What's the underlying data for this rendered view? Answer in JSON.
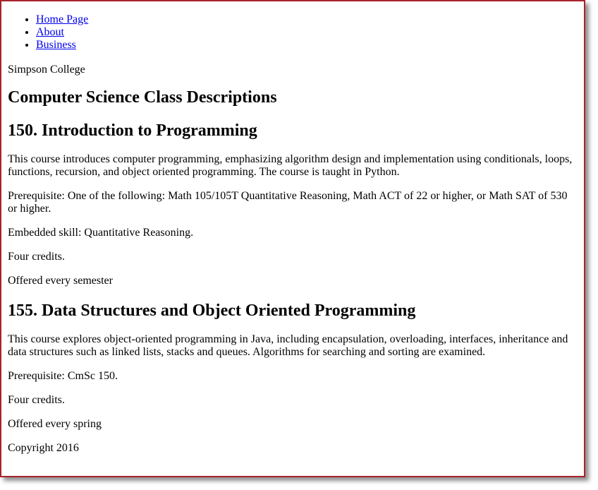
{
  "nav": {
    "items": [
      {
        "label": "Home Page"
      },
      {
        "label": "About"
      },
      {
        "label": "Business"
      }
    ]
  },
  "site_name": "Simpson College",
  "page_title": "Computer Science Class Descriptions",
  "courses": [
    {
      "title": "150. Introduction to Programming",
      "description": "This course introduces computer programming, emphasizing algorithm design and implementation using conditionals, loops, functions, recursion, and object oriented programming. The course is taught in Python.",
      "prerequisite": "Prerequisite: One of the following: Math 105/105T Quantitative Reasoning, Math ACT of 22 or higher, or Math SAT of 530 or higher.",
      "skill": "Embedded skill: Quantitative Reasoning.",
      "credits": "Four credits.",
      "offered": "Offered every semester"
    },
    {
      "title": "155. Data Structures and Object Oriented Programming",
      "description": "This course explores object-oriented programming in Java, including encapsulation, overloading, interfaces, inheritance and data structures such as linked lists, stacks and queues. Algorithms for searching and sorting are examined.",
      "prerequisite": "Prerequisite: CmSc 150.",
      "credits": "Four credits.",
      "offered": "Offered every spring"
    }
  ],
  "footer": "Copyright 2016",
  "colors": {
    "link": "#0000ee",
    "frame_border": "#a8232b",
    "text": "#000000"
  }
}
